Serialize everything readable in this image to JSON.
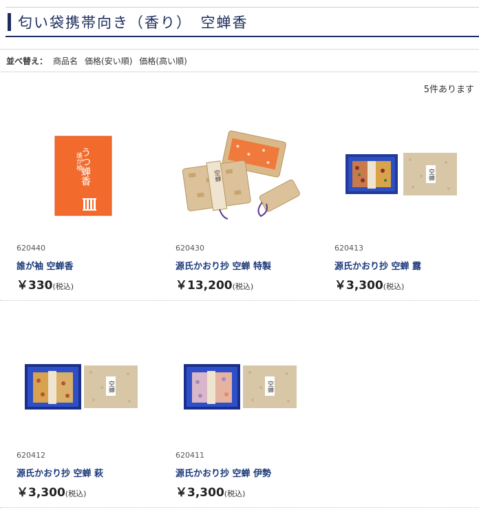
{
  "page": {
    "title": "匂い袋携帯向き（香り）　空蝉香"
  },
  "sort": {
    "label": "並べ替え：",
    "options": [
      "商品名",
      "価格(安い順)",
      "価格(高い順)"
    ]
  },
  "result_count": "5件あります",
  "products": [
    {
      "code": "620440",
      "name": "誰が袖 空蝉香",
      "price": "￥330",
      "tax": "(税込)",
      "image": "orange-sachet-image",
      "sachet_text": "誰が袖\nうつ蝉香"
    },
    {
      "code": "620430",
      "name": "源氏かおり抄 空蝉 特製",
      "price": "￥13,200",
      "tax": "(税込)",
      "image": "gold-brocade-pouches-image",
      "label_text": "空蝉"
    },
    {
      "code": "620413",
      "name": "源氏かおり抄 空蝉 露",
      "price": "￥3,300",
      "tax": "(税込)",
      "image": "boxed-set-image",
      "label_text": "空蝉"
    },
    {
      "code": "620412",
      "name": "源氏かおり抄 空蝉 萩",
      "price": "￥3,300",
      "tax": "(税込)",
      "image": "boxed-set-image",
      "label_text": "空蝉"
    },
    {
      "code": "620411",
      "name": "源氏かおり抄 空蝉 伊勢",
      "price": "￥3,300",
      "tax": "(税込)",
      "image": "boxed-set-image",
      "label_text": "空蝉"
    }
  ],
  "colors": {
    "heading": "#1c2d5c",
    "product_name": "#1c3a7a",
    "sachet_orange": "#f26b2c",
    "box_navy": "#1f3a9a",
    "kraft": "#d8c7a6"
  }
}
